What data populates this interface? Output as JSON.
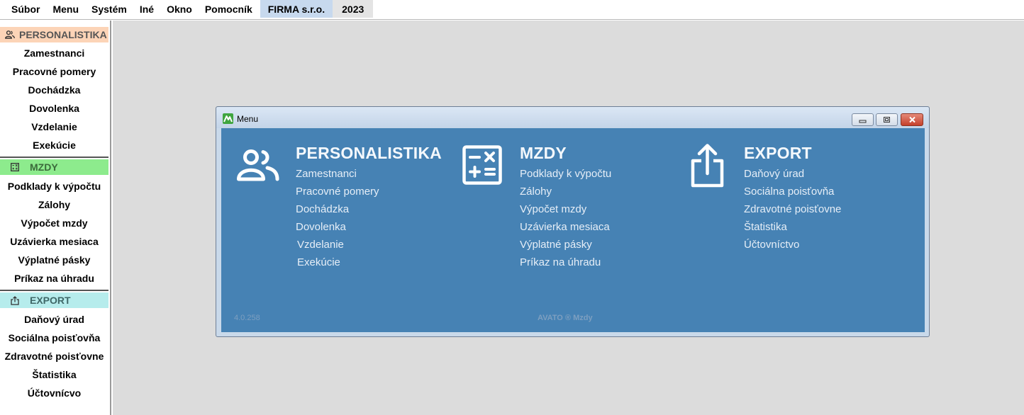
{
  "menubar": {
    "items": [
      "Súbor",
      "Menu",
      "Systém",
      "Iné",
      "Okno",
      "Pomocník"
    ],
    "firm": "FIRMA s.r.o.",
    "year": "2023"
  },
  "sidebar": {
    "personalistika": {
      "title": "PERSONALISTIKA",
      "icon": "people-icon",
      "color": "#fcd4b7",
      "items": [
        "Zamestnanci",
        "Pracovné pomery",
        "Dochádzka",
        "Dovolenka",
        "Vzdelanie",
        "Exekúcie"
      ]
    },
    "mzdy": {
      "title": "MZDY",
      "icon": "calculator-icon",
      "color": "#8deb8d",
      "items": [
        "Podklady k výpočtu",
        "Zálohy",
        "Výpočet mzdy",
        "Uzávierka mesiaca",
        "Výplatné pásky",
        "Príkaz na úhradu"
      ]
    },
    "export": {
      "title": "EXPORT",
      "icon": "share-icon",
      "color": "#b6ecec",
      "items": [
        "Daňový úrad",
        "Sociálna poisťovňa",
        "Zdravotné poisťovne",
        "Štatistika",
        "Účtovnícvo"
      ]
    }
  },
  "window": {
    "title": "Menu",
    "columns": [
      {
        "heading": "PERSONALISTIKA",
        "icon": "people-icon",
        "links": [
          "Zamestnanci",
          "Pracovné pomery",
          "Dochádzka",
          "Dovolenka",
          "Vzdelanie",
          "Exekúcie"
        ]
      },
      {
        "heading": "MZDY",
        "icon": "calculator-icon",
        "links": [
          "Podklady k výpočtu",
          "Zálohy",
          "Výpočet mzdy",
          "Uzávierka mesiaca",
          "Výplatné pásky",
          "Príkaz na úhradu"
        ]
      },
      {
        "heading": "EXPORT",
        "icon": "share-icon",
        "links": [
          "Daňový úrad",
          "Sociálna poisťovňa",
          "Zdravotné poisťovne",
          "Štatistika",
          "Účtovníctvo"
        ]
      }
    ],
    "version": "4.0.258",
    "brand": "AVATO ® Mzdy",
    "accent": "#4682b4"
  }
}
